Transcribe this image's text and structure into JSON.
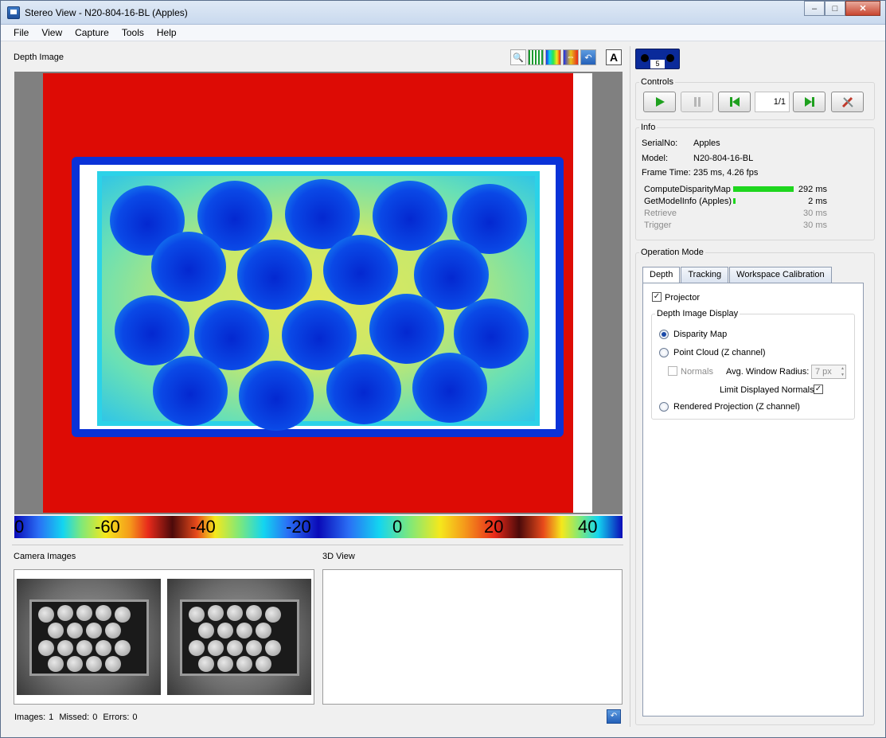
{
  "window": {
    "title": "Stereo View - N20-804-16-BL (Apples)",
    "buttons": {
      "minimize": "–",
      "maximize": "□",
      "close": "✕"
    }
  },
  "menu": [
    "File",
    "View",
    "Capture",
    "Tools",
    "Help"
  ],
  "depth_image": {
    "label": "Depth Image",
    "text_toggle": "A",
    "colorbar_labels": [
      "0",
      "-60",
      "-40",
      "-20",
      "0",
      "20",
      "40"
    ]
  },
  "camera_images": {
    "label": "Camera Images"
  },
  "view3d": {
    "label": "3D View"
  },
  "status": {
    "images_label": "Images:",
    "images_value": "1",
    "missed_label": "Missed:",
    "missed_value": "0",
    "errors_label": "Errors:",
    "errors_value": "0"
  },
  "camera_tab": {
    "number": "5"
  },
  "controls": {
    "title": "Controls",
    "frame_counter": "1/1"
  },
  "info": {
    "title": "Info",
    "serial_label": "SerialNo:",
    "serial_value": "Apples",
    "model_label": "Model:",
    "model_value": "N20-804-16-BL",
    "frametime_label": "Frame Time:",
    "frametime_value": "235 ms, 4.26 fps",
    "timings": [
      {
        "name": "ComputeDisparityMap",
        "value": "292 ms",
        "fraction": 1.0,
        "active": true
      },
      {
        "name": "GetModelInfo (Apples)",
        "value": "2 ms",
        "fraction": 0.04,
        "active": true
      },
      {
        "name": "Retrieve",
        "value": "30 ms",
        "fraction": 0,
        "active": false
      },
      {
        "name": "Trigger",
        "value": "30 ms",
        "fraction": 0,
        "active": false
      }
    ]
  },
  "operation_mode": {
    "title": "Operation Mode",
    "tabs": [
      "Depth",
      "Tracking",
      "Workspace Calibration"
    ],
    "projector_label": "Projector",
    "depth_display_title": "Depth Image Display",
    "disparity_map_label": "Disparity Map",
    "point_cloud_label": "Point Cloud (Z channel)",
    "normals_label": "Normals",
    "avg_window_label": "Avg. Window Radius:",
    "avg_window_value": "7 px",
    "limit_normals_label": "Limit Displayed Normals",
    "rendered_projection_label": "Rendered Projection (Z channel)"
  }
}
